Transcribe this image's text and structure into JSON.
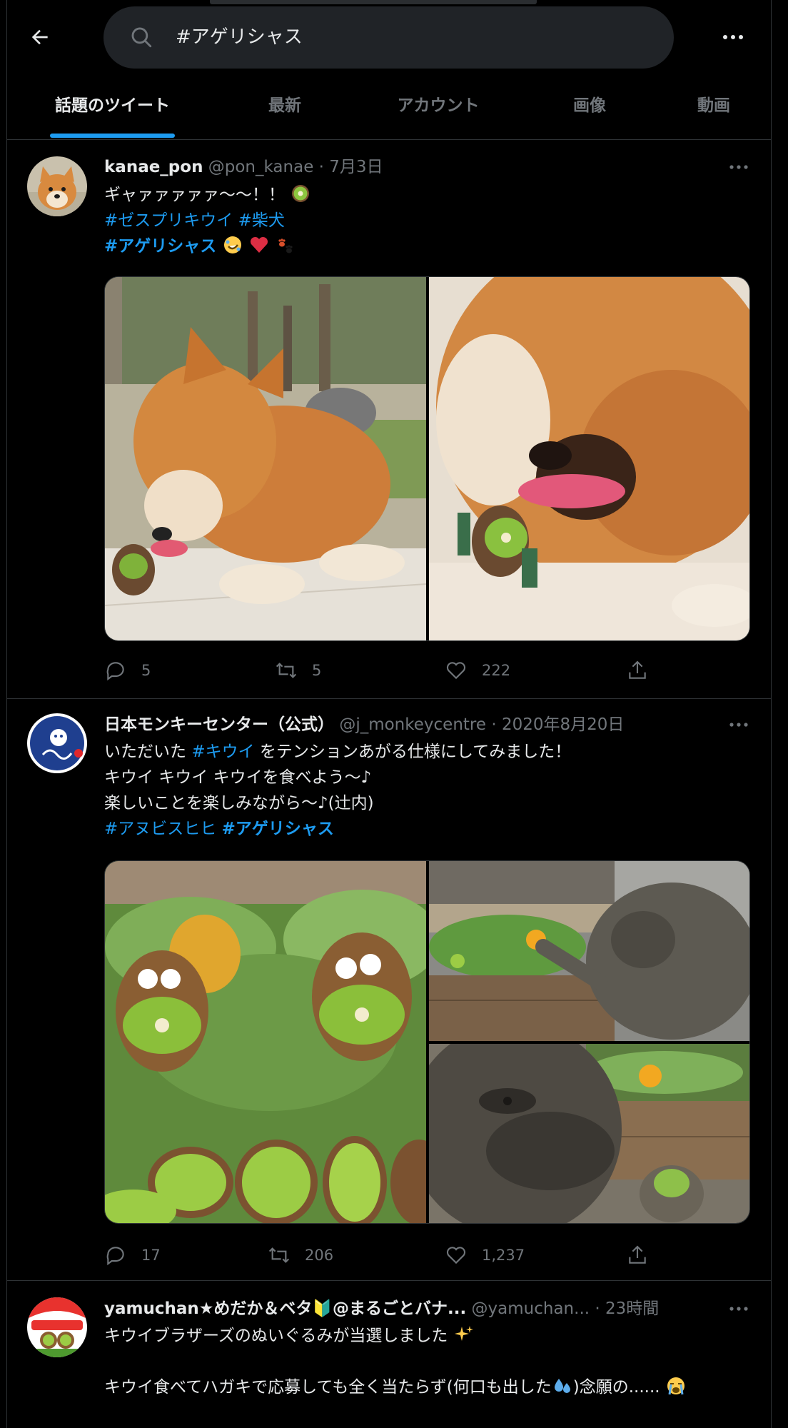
{
  "header": {
    "search_value": "#アゲリシャス"
  },
  "tabs": [
    {
      "label": "話題のツイート",
      "active": true
    },
    {
      "label": "最新",
      "active": false
    },
    {
      "label": "アカウント",
      "active": false
    },
    {
      "label": "画像",
      "active": false
    },
    {
      "label": "動画",
      "active": false
    }
  ],
  "colors": {
    "background": "#000000",
    "accent": "#1d9bf0",
    "muted_text": "#71767b",
    "divider": "#2f3336",
    "search_bg": "#202327"
  },
  "tweets": [
    {
      "display_name": "kanae_pon",
      "handle": "@pon_kanae",
      "separator": "·",
      "time": "7月3日",
      "avatar_icon": "shiba-dog-avatar",
      "body": {
        "l1_text": "ギャァァァァァ〜〜！！",
        "l1_emoji": "kiwi-emoji",
        "l2_tag1": "#ゼスプリキウイ",
        "l2_tag2": "#柴犬",
        "l3_tag": "#アゲリシャス",
        "l3_emojis": [
          "rofl-emoji",
          "red-heart-emoji",
          "paw-prints-emoji"
        ]
      },
      "media": [
        "shiba-dog-licking-kiwi-toy-photo",
        "shiba-dog-closeup-kiwi-toy-photo"
      ],
      "stats": {
        "replies": "5",
        "retweets": "5",
        "likes": "222"
      }
    },
    {
      "display_name": "日本モンキーセンター（公式）",
      "handle": "@j_monkeycentre",
      "separator": "·",
      "time": "2020年8月20日",
      "avatar_icon": "monkey-centre-logo-avatar",
      "body": {
        "l1_pre": "いただいた ",
        "l1_tag": "#キウイ",
        "l1_post": " をテンションあがる仕様にしてみました！",
        "l2": "キウイ キウイ キウイを食べよう〜♪",
        "l3": "楽しいことを楽しみながら〜♪(辻内)",
        "l4_tag1": "#アヌビスヒヒ",
        "l4_tag2": "#アゲリシャス"
      },
      "media": [
        "kiwi-faces-on-greens-photo",
        "baboon-eating-vegetables-photo",
        "baboon-closeup-photo"
      ],
      "stats": {
        "replies": "17",
        "retweets": "206",
        "likes": "1,237"
      }
    },
    {
      "display_name": "yamuchan★めだか＆ベタ🔰@まるごとバナ...",
      "handle": "@yamuchan...",
      "separator": "·",
      "time": "23時間",
      "avatar_icon": "yamuchan-logo-avatar",
      "body": {
        "l1_text": "キウイブラザーズのぬいぐるみが当選しました",
        "l1_emoji": "sparkles-emoji",
        "l3_pre": "キウイ食べてハガキで応募しても全く当たらず(何口も出した",
        "l3_emoji1": "sweat-droplets-emoji",
        "l3_post": ")念願の......",
        "l3_emoji2": "loudly-crying-face-emoji"
      }
    }
  ]
}
